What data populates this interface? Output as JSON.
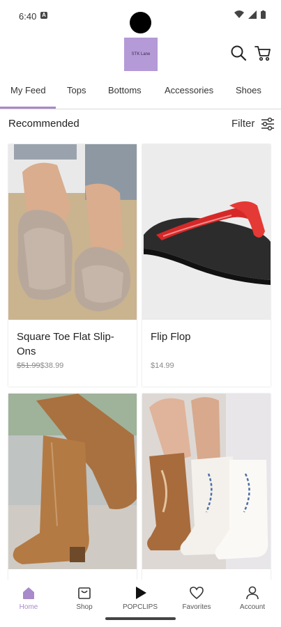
{
  "status": {
    "time": "6:40",
    "notif_glyph": "A"
  },
  "header": {
    "logo_text": "STK Lane"
  },
  "tabs": [
    {
      "label": "My Feed"
    },
    {
      "label": "Tops"
    },
    {
      "label": "Bottoms"
    },
    {
      "label": "Accessories"
    },
    {
      "label": "Shoes"
    }
  ],
  "section": {
    "title": "Recommended",
    "filter_label": "Filter"
  },
  "products": [
    {
      "title": "Square Toe Flat Slip-Ons",
      "old_price": "$51.99",
      "price": "$38.99"
    },
    {
      "title": "Flip Flop",
      "price": "$14.99"
    },
    {
      "title": ""
    },
    {
      "title": ""
    }
  ],
  "nav": [
    {
      "label": "Home"
    },
    {
      "label": "Shop"
    },
    {
      "label": "POPCLIPS"
    },
    {
      "label": "Favorites"
    },
    {
      "label": "Account"
    }
  ],
  "colors": {
    "accent": "#a889c9",
    "logo_bg": "#b49ad6"
  }
}
